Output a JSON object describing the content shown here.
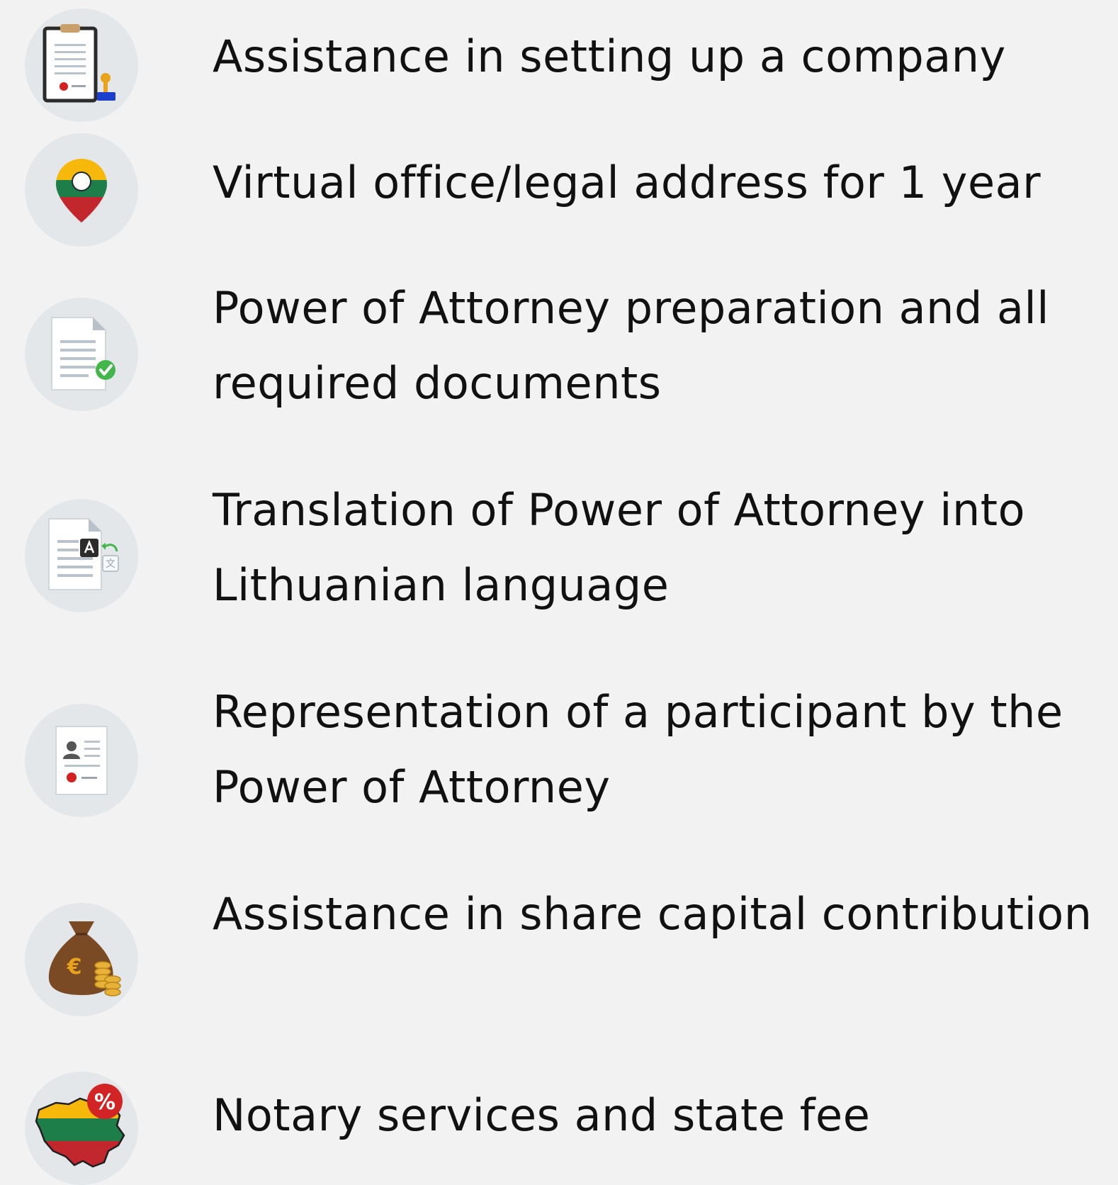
{
  "services": [
    {
      "label": "Assistance in setting up a company",
      "icon": "clipboard-stamp-icon"
    },
    {
      "label": "Virtual office/legal address for 1 year",
      "icon": "map-pin-icon"
    },
    {
      "label": "Power of Attorney preparation and all required documents",
      "icon": "document-check-icon"
    },
    {
      "label": "Translation of Power of Attorney into Lithuanian language",
      "icon": "document-translate-icon"
    },
    {
      "label": "Representation of a participant by the Power of Attorney",
      "icon": "document-person-icon"
    },
    {
      "label": "Assistance in share capital contribution",
      "icon": "money-bag-icon"
    },
    {
      "label": "Notary services and state fee",
      "icon": "lithuania-map-percent-icon"
    }
  ],
  "colors": {
    "background": "#f2f2f2",
    "icon_circle": "#e4e7ea",
    "text": "#111111",
    "flag_yellow": "#f5b80b",
    "flag_green": "#1e7e4a",
    "flag_red": "#c1272d",
    "check_green": "#43b649",
    "stamp_blue": "#1a3fcc",
    "bag_brown": "#7a4a25",
    "coin_gold": "#e8b23a"
  }
}
